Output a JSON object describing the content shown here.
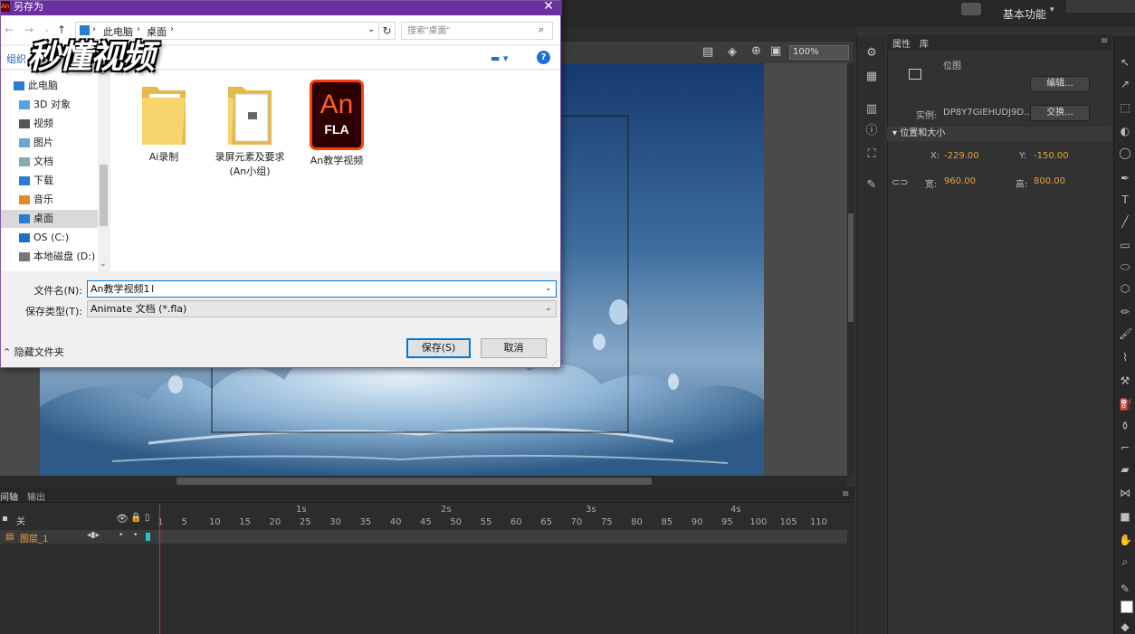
{
  "app": {
    "workspace": "基本功能",
    "zoom": "100%",
    "props_tabs": [
      "属性",
      "库"
    ],
    "props": {
      "symbol_type": "位图",
      "edit_button": "编辑...",
      "instance_label": "实例:",
      "instance_value": "DP8Y7GIEHUDJ9D...",
      "swap_button": "交换...",
      "section": "位置和大小",
      "x_label": "X:",
      "x_value": "-229.00",
      "y_label": "Y:",
      "y_value": "-150.00",
      "w_label": "宽:",
      "w_value": "960.00",
      "h_label": "高:",
      "h_value": "800.00"
    },
    "timeline": {
      "tabs": [
        "间轴",
        "输出"
      ],
      "off_label": "关",
      "layer_name": "图层_1",
      "seconds": [
        "1s",
        "2s",
        "3s",
        "4s"
      ],
      "frames": [
        "1",
        "5",
        "10",
        "15",
        "20",
        "25",
        "30",
        "35",
        "40",
        "45",
        "50",
        "55",
        "60",
        "65",
        "70",
        "75",
        "80",
        "85",
        "90",
        "95",
        "100",
        "105",
        "110"
      ]
    }
  },
  "dialog": {
    "title": "另存为",
    "breadcrumb": [
      "此电脑",
      "桌面"
    ],
    "search_placeholder": "搜索\"桌面\"",
    "organize": "组织",
    "nav_items": [
      {
        "label": "此电脑",
        "icon": "computer-icon"
      },
      {
        "label": "3D 对象",
        "icon": "folder-3d-icon"
      },
      {
        "label": "视频",
        "icon": "video-folder-icon"
      },
      {
        "label": "图片",
        "icon": "picture-folder-icon"
      },
      {
        "label": "文档",
        "icon": "document-folder-icon"
      },
      {
        "label": "下载",
        "icon": "download-folder-icon"
      },
      {
        "label": "音乐",
        "icon": "music-folder-icon"
      },
      {
        "label": "桌面",
        "icon": "desktop-folder-icon"
      },
      {
        "label": "OS (C:)",
        "icon": "drive-c-icon"
      },
      {
        "label": "本地磁盘 (D:)",
        "icon": "drive-d-icon"
      }
    ],
    "files": [
      {
        "name": "Ai录制",
        "type": "folder"
      },
      {
        "name": "录屏元素及要求\n(An小组)",
        "type": "folder-doc"
      },
      {
        "name": "An教学视频",
        "type": "fla"
      }
    ],
    "fla_icon_text": "An",
    "fla_icon_sub": "FLA",
    "filename_label": "文件名(N):",
    "filename_value": "An教学视频1",
    "savetype_label": "保存类型(T):",
    "savetype_value": "Animate 文档 (*.fla)",
    "hide_folders": "隐藏文件夹",
    "save_button": "保存(S)",
    "cancel_button": "取消"
  },
  "watermark": "秒懂视频"
}
